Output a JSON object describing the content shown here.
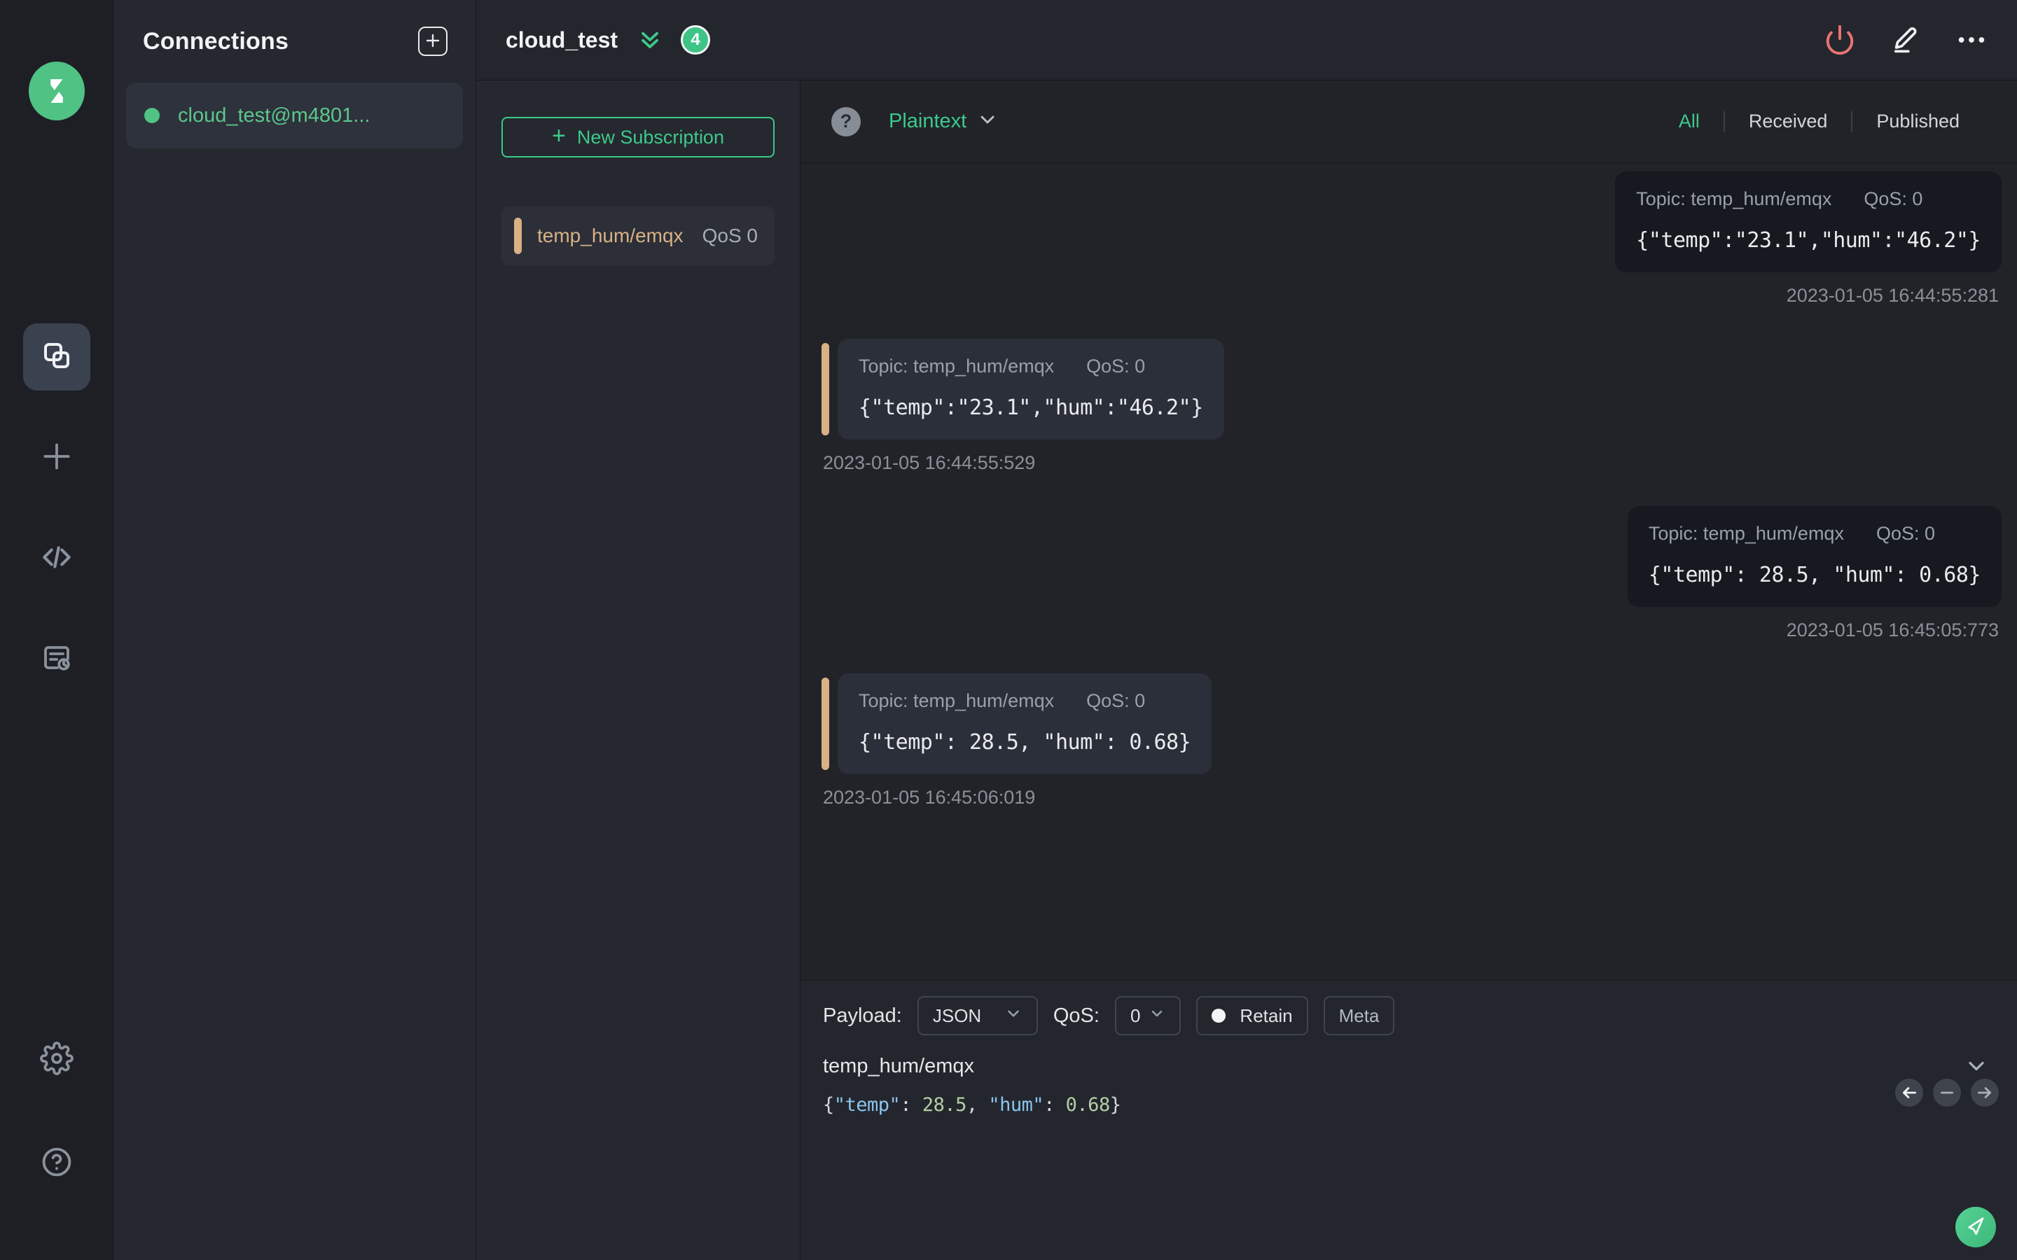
{
  "colors": {
    "accent_green": "#3dc98a",
    "accent_orange": "#d9b184",
    "danger_red": "#e87272",
    "bubble_publish": "#16191f",
    "bubble_receive": "#2b2f39"
  },
  "rail": {
    "logo": "mqttx-logo",
    "items": [
      {
        "name": "connections",
        "active": true
      },
      {
        "name": "new-connection",
        "active": false
      },
      {
        "name": "script",
        "active": false
      },
      {
        "name": "log",
        "active": false
      },
      {
        "name": "settings",
        "active": false
      },
      {
        "name": "help",
        "active": false
      }
    ]
  },
  "connections_panel": {
    "title": "Connections",
    "item": {
      "name": "cloud_test@m4801...",
      "status": "connected"
    }
  },
  "header": {
    "title": "cloud_test",
    "badge_count": "4"
  },
  "subscriptions": {
    "new_button_label": "New Subscription",
    "items": [
      {
        "topic": "temp_hum/emqx",
        "qos": "QoS 0"
      }
    ]
  },
  "toolbar": {
    "help": "?",
    "format": "Plaintext",
    "filters": {
      "all": "All",
      "received": "Received",
      "published": "Published",
      "active": "All"
    }
  },
  "messages": [
    {
      "direction": "publish",
      "topic_label": "Topic: temp_hum/emqx",
      "qos_label": "QoS: 0",
      "payload": "{\"temp\":\"23.1\",\"hum\":\"46.2\"}",
      "time": "2023-01-05 16:44:55:281"
    },
    {
      "direction": "receive",
      "topic_label": "Topic: temp_hum/emqx",
      "qos_label": "QoS: 0",
      "payload": "{\"temp\":\"23.1\",\"hum\":\"46.2\"}",
      "time": "2023-01-05 16:44:55:529"
    },
    {
      "direction": "publish",
      "topic_label": "Topic: temp_hum/emqx",
      "qos_label": "QoS: 0",
      "payload": "{\"temp\": 28.5, \"hum\": 0.68}",
      "time": "2023-01-05 16:45:05:773"
    },
    {
      "direction": "receive",
      "topic_label": "Topic: temp_hum/emqx",
      "qos_label": "QoS: 0",
      "payload": "{\"temp\": 28.5, \"hum\": 0.68}",
      "time": "2023-01-05 16:45:06:019"
    }
  ],
  "composer": {
    "payload_label": "Payload:",
    "payload_type": "JSON",
    "qos_label": "QoS:",
    "qos_value": "0",
    "retain_label": "Retain",
    "meta_label": "Meta",
    "topic": "temp_hum/emqx",
    "payload_text": "{\"temp\": 28.5, \"hum\": 0.68}",
    "payload_segments": [
      {
        "text": "{",
        "type": "punct"
      },
      {
        "text": "\"temp\"",
        "type": "key"
      },
      {
        "text": ": ",
        "type": "punct"
      },
      {
        "text": "28.5",
        "type": "number"
      },
      {
        "text": ", ",
        "type": "punct"
      },
      {
        "text": "\"hum\"",
        "type": "key"
      },
      {
        "text": ": ",
        "type": "punct"
      },
      {
        "text": "0.68",
        "type": "number"
      },
      {
        "text": "}",
        "type": "punct"
      }
    ]
  }
}
